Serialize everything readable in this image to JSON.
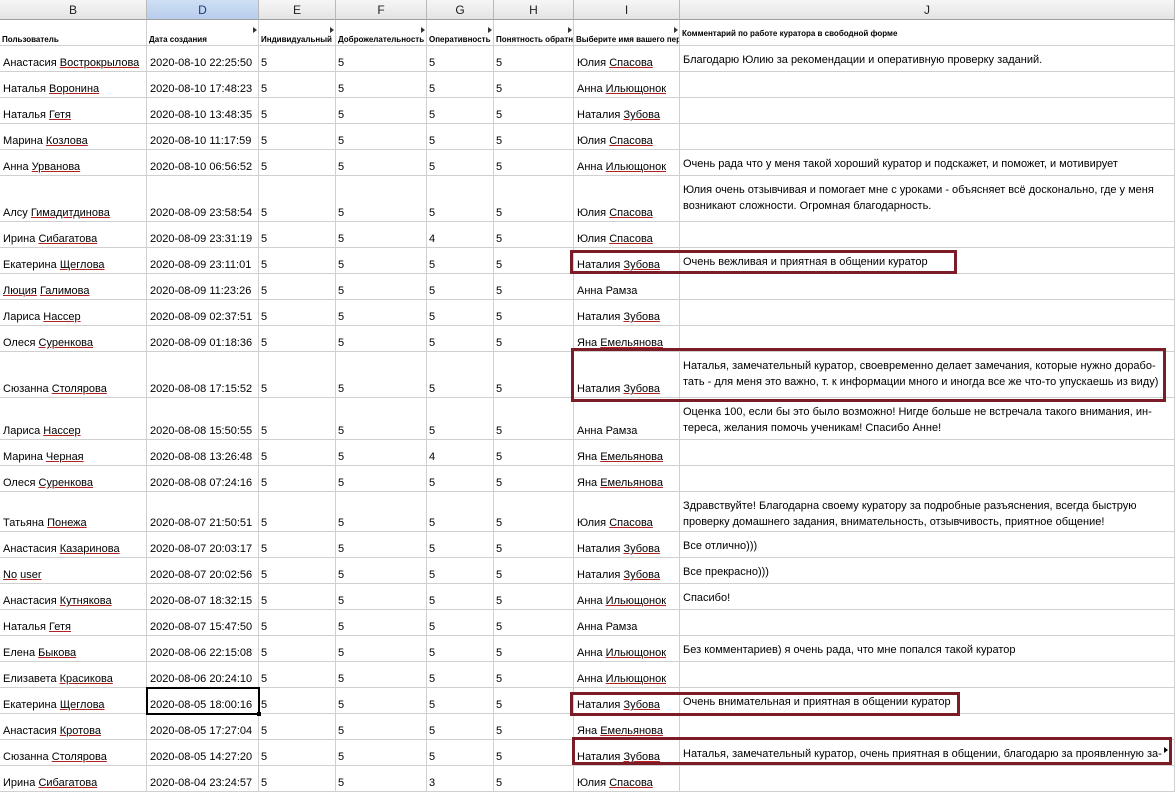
{
  "columns": [
    "B",
    "D",
    "E",
    "F",
    "G",
    "H",
    "I",
    "J"
  ],
  "selected_column": "D",
  "headers": [
    "Пользователь",
    "Дата создания",
    "Индивидуальный",
    "Доброжелательность",
    "Оперативность",
    "Понятность обратн",
    "Выберите  имя вашего пер",
    "Комментарий по работе куратора в свободной форме"
  ],
  "rows": [
    {
      "user": [
        "Анастасия",
        "Вострокрылова"
      ],
      "date": "2020-08-10 22:25:50",
      "e": "5",
      "f": "5",
      "g": "5",
      "h": "5",
      "curator": [
        "Юлия",
        "Спасова"
      ],
      "comment": "Благодарю Юлию за рекомендации и оперативную проверку заданий."
    },
    {
      "user": [
        "Наталья",
        "Воронина"
      ],
      "date": "2020-08-10 17:48:23",
      "e": "5",
      "f": "5",
      "g": "5",
      "h": "5",
      "curator": [
        "Анна",
        "Ильющонок"
      ],
      "comment": ""
    },
    {
      "user": [
        "Наталья",
        "Гетя"
      ],
      "date": "2020-08-10 13:48:35",
      "e": "5",
      "f": "5",
      "g": "5",
      "h": "5",
      "curator": [
        "Наталия",
        "Зубова"
      ],
      "comment": ""
    },
    {
      "user": [
        "Марина",
        "Козлова"
      ],
      "date": "2020-08-10 11:17:59",
      "e": "5",
      "f": "5",
      "g": "5",
      "h": "5",
      "curator": [
        "Юлия",
        "Спасова"
      ],
      "comment": ""
    },
    {
      "user": [
        "Анна",
        "Урванова"
      ],
      "date": "2020-08-10 06:56:52",
      "e": "5",
      "f": "5",
      "g": "5",
      "h": "5",
      "curator": [
        "Анна",
        "Ильющонок"
      ],
      "comment": "Очень рада что у меня такой хороший куратор и подскажет, и поможет, и мотивирует"
    },
    {
      "user": [
        "Алсу",
        "Гимадитдинова"
      ],
      "date": "2020-08-09 23:58:54",
      "e": "5",
      "f": "5",
      "g": "5",
      "h": "5",
      "curator": [
        "Юлия",
        "Спасова"
      ],
      "comment": "Юлия очень отзывчивая и помогает мне с уроками - объясняет всё досконально, где у меня возникают сложности. Огромная благодарность."
    },
    {
      "user": [
        "Ирина",
        "Сибагатова"
      ],
      "date": "2020-08-09 23:31:19",
      "e": "5",
      "f": "5",
      "g": "4",
      "h": "5",
      "curator": [
        "Юлия",
        "Спасова"
      ],
      "comment": ""
    },
    {
      "user": [
        "Екатерина",
        "Щеглова"
      ],
      "date": "2020-08-09 23:11:01",
      "e": "5",
      "f": "5",
      "g": "5",
      "h": "5",
      "curator": [
        "Наталия",
        "Зубова"
      ],
      "comment": "Очень вежливая и приятная в общении куратор"
    },
    {
      "user": [
        "Люция",
        "Галимова"
      ],
      "date": "2020-08-09 11:23:26",
      "e": "5",
      "f": "5",
      "g": "5",
      "h": "5",
      "curator": [
        "Анна",
        "Рамза"
      ],
      "comment": ""
    },
    {
      "user": [
        "Лариса",
        "Нассер"
      ],
      "date": "2020-08-09 02:37:51",
      "e": "5",
      "f": "5",
      "g": "5",
      "h": "5",
      "curator": [
        "Наталия",
        "Зубова"
      ],
      "comment": ""
    },
    {
      "user": [
        "Олеся",
        "Суренкова"
      ],
      "date": "2020-08-09 01:18:36",
      "e": "5",
      "f": "5",
      "g": "5",
      "h": "5",
      "curator": [
        "Яна",
        "Емельянова"
      ],
      "comment": ""
    },
    {
      "user": [
        "Сюзанна",
        "Столярова"
      ],
      "date": "2020-08-08 17:15:52",
      "e": "5",
      "f": "5",
      "g": "5",
      "h": "5",
      "curator": [
        "Наталия",
        "Зубова"
      ],
      "comment": "Наталья, замечательный куратор, своевременно делает замечания, которые нужно дорабо-тать - для меня это важно, т. к информации много и иногда все же что-то упускаешь из виду)"
    },
    {
      "user": [
        "Лариса",
        "Нассер"
      ],
      "date": "2020-08-08 15:50:55",
      "e": "5",
      "f": "5",
      "g": "5",
      "h": "5",
      "curator": [
        "Анна",
        "Рамза"
      ],
      "comment": "Оценка 100, если бы это было возможно! Нигде больше не встречала такого внимания, ин-тереса, желания помочь ученикам! Спасибо Анне!"
    },
    {
      "user": [
        "Марина",
        "Черная"
      ],
      "date": "2020-08-08 13:26:48",
      "e": "5",
      "f": "5",
      "g": "4",
      "h": "5",
      "curator": [
        "Яна",
        "Емельянова"
      ],
      "comment": ""
    },
    {
      "user": [
        "Олеся",
        "Суренкова"
      ],
      "date": "2020-08-08 07:24:16",
      "e": "5",
      "f": "5",
      "g": "5",
      "h": "5",
      "curator": [
        "Яна",
        "Емельянова"
      ],
      "comment": ""
    },
    {
      "user": [
        "Татьяна",
        "Понежа"
      ],
      "date": "2020-08-07 21:50:51",
      "e": "5",
      "f": "5",
      "g": "5",
      "h": "5",
      "curator": [
        "Юлия",
        "Спасова"
      ],
      "comment": "Здравствуйте! Благодарна своему куратору за подробные разъяснения, всегда быструю проверку домашнего задания, внимательность, отзывчивость, приятное общение!"
    },
    {
      "user": [
        "Анастасия",
        "Казаринова"
      ],
      "date": "2020-08-07 20:03:17",
      "e": "5",
      "f": "5",
      "g": "5",
      "h": "5",
      "curator": [
        "Наталия",
        "Зубова"
      ],
      "comment": "Все отлично)))"
    },
    {
      "user": [
        "No",
        "user"
      ],
      "date": "2020-08-07 20:02:56",
      "e": "5",
      "f": "5",
      "g": "5",
      "h": "5",
      "curator": [
        "Наталия",
        "Зубова"
      ],
      "comment": "Все прекрасно)))"
    },
    {
      "user": [
        "Анастасия",
        "Кутнякова"
      ],
      "date": "2020-08-07 18:32:15",
      "e": "5",
      "f": "5",
      "g": "5",
      "h": "5",
      "curator": [
        "Анна",
        "Ильющонок"
      ],
      "comment": "Спасибо!"
    },
    {
      "user": [
        "Наталья",
        "Гетя"
      ],
      "date": "2020-08-07 15:47:50",
      "e": "5",
      "f": "5",
      "g": "5",
      "h": "5",
      "curator": [
        "Анна",
        "Рамза"
      ],
      "comment": ""
    },
    {
      "user": [
        "Елена",
        "Быкова"
      ],
      "date": "2020-08-06 22:15:08",
      "e": "5",
      "f": "5",
      "g": "5",
      "h": "5",
      "curator": [
        "Анна",
        "Ильющонок"
      ],
      "comment": "Без комментариев) я очень рада, что мне попался такой куратор"
    },
    {
      "user": [
        "Елизавета",
        "Красикова"
      ],
      "date": "2020-08-06 20:24:10",
      "e": "5",
      "f": "5",
      "g": "5",
      "h": "5",
      "curator": [
        "Анна",
        "Ильющонок"
      ],
      "comment": ""
    },
    {
      "user": [
        "Екатерина",
        "Щеглова"
      ],
      "date": "2020-08-05 18:00:16",
      "e": "5",
      "f": "5",
      "g": "5",
      "h": "5",
      "curator": [
        "Наталия",
        "Зубова"
      ],
      "comment": "Очень внимательная и приятная в общении куратор"
    },
    {
      "user": [
        "Анастасия",
        "Кротова"
      ],
      "date": "2020-08-05 17:27:04",
      "e": "5",
      "f": "5",
      "g": "5",
      "h": "5",
      "curator": [
        "Яна",
        "Емельянова"
      ],
      "comment": ""
    },
    {
      "user": [
        "Сюзанна",
        "Столярова"
      ],
      "date": "2020-08-05 14:27:20",
      "e": "5",
      "f": "5",
      "g": "5",
      "h": "5",
      "curator": [
        "Наталия",
        "Зубова"
      ],
      "comment": "Наталья, замечательный куратор, очень приятная в общении, благодарю за проявленную за-боту и внимание)"
    },
    {
      "user": [
        "Ирина",
        "Сибагатова"
      ],
      "date": "2020-08-04 23:24:57",
      "e": "5",
      "f": "5",
      "g": "3",
      "h": "5",
      "curator": [
        "Юлия",
        "Спасова"
      ],
      "comment": ""
    }
  ],
  "active_cell": {
    "column": "D",
    "value": "2020-08-05 18:00:16"
  },
  "highlight_color": "#7b1c26"
}
